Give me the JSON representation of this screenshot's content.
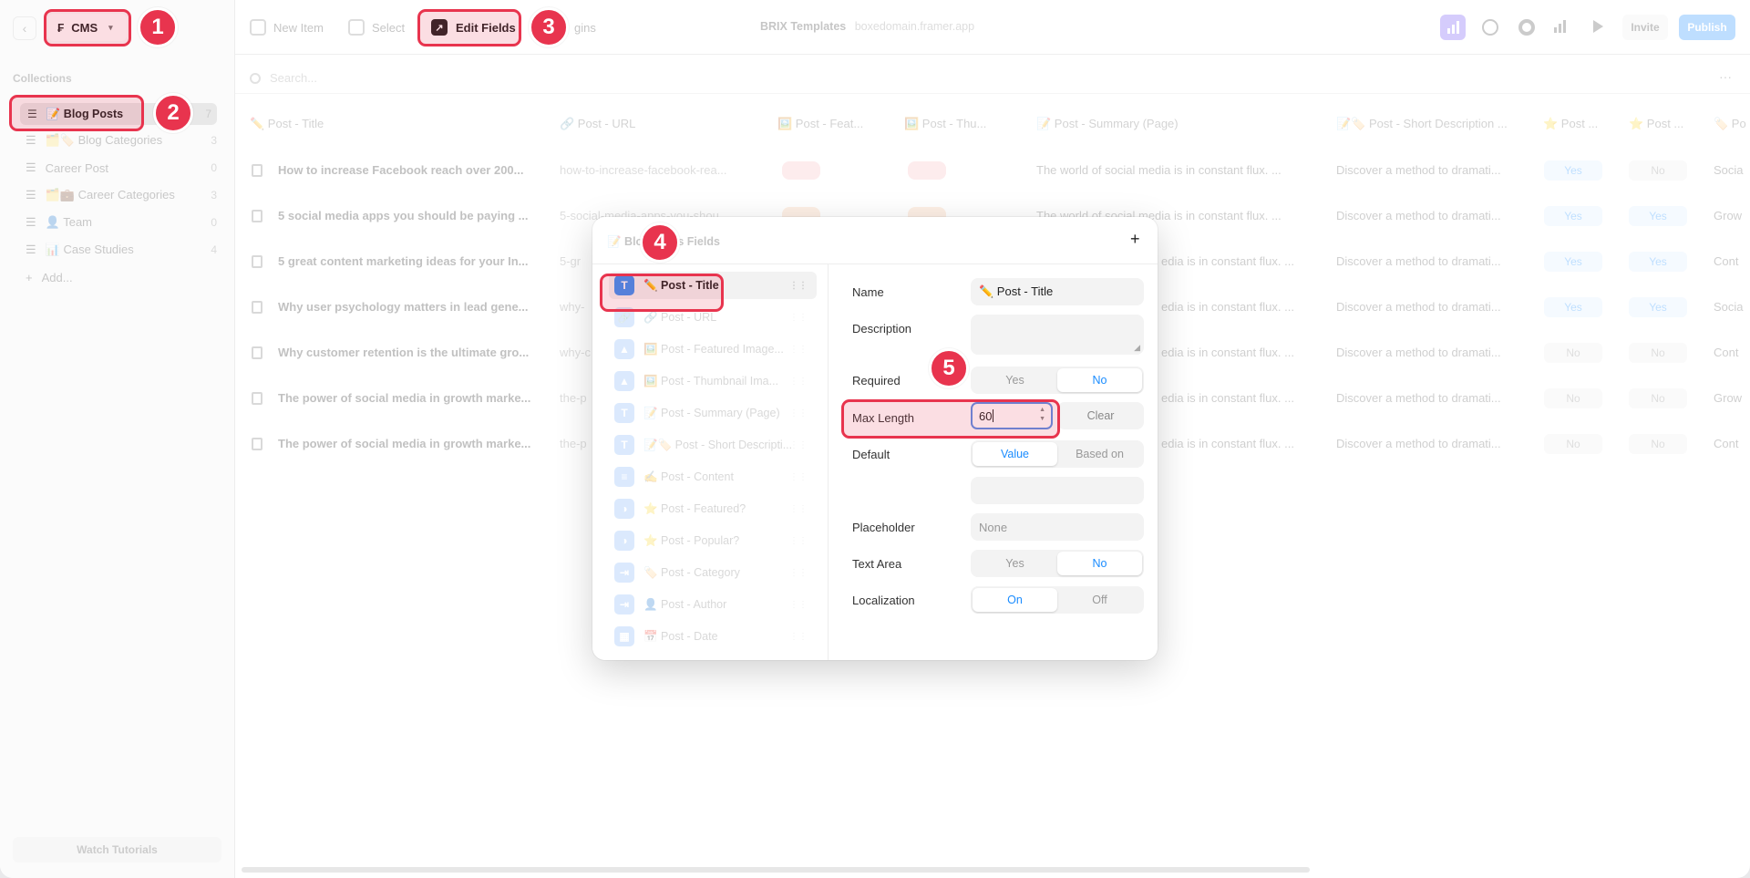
{
  "topbar": {
    "cms_label": "CMS",
    "new_item": "New Item",
    "select": "Select",
    "edit_fields": "Edit Fields",
    "plugins_partial": "gins",
    "project_name": "BRIX Templates",
    "project_domain": "boxedomain.framer.app",
    "invite": "Invite",
    "publish": "Publish"
  },
  "sidebar": {
    "section_title": "Collections",
    "items": [
      {
        "label": "📝 Blog Posts",
        "count": "7"
      },
      {
        "label": "🗂️🏷️ Blog Categories",
        "count": "3"
      },
      {
        "label": "Career Post",
        "count": "0"
      },
      {
        "label": "🗂️💼 Career Categories",
        "count": "3"
      },
      {
        "label": "👤 Team",
        "count": "0"
      },
      {
        "label": "📊 Case Studies",
        "count": "4"
      }
    ],
    "add_label": "Add...",
    "watch_tutorials": "Watch Tutorials"
  },
  "table": {
    "search_placeholder": "Search...",
    "columns": [
      "✏️ Post - Title",
      "🔗 Post - URL",
      "🖼️ Post - Feat...",
      "🖼️ Post - Thu...",
      "📝 Post - Summary (Page)",
      "📝🏷️ Post - Short Description ...",
      "⭐ Post ...",
      "⭐ Post ...",
      "🏷️ Po"
    ],
    "rows": [
      {
        "title": "How to increase Facebook reach over 200...",
        "url": "how-to-increase-facebook-rea...",
        "summary": "The world of social media is in constant flux. ...",
        "short": "Discover a method to dramati...",
        "f1": "Yes",
        "f2": "No",
        "cat": "Socia"
      },
      {
        "title": "5 social media apps you should be paying ...",
        "url": "5-social-media-apps-you-shou...",
        "summary": "The world of social media is in constant flux. ...",
        "short": "Discover a method to dramati...",
        "f1": "Yes",
        "f2": "Yes",
        "cat": "Grow"
      },
      {
        "title": "5 great content marketing ideas for your In...",
        "url": "5-gr",
        "summary": "edia is in constant flux. ...",
        "short": "Discover a method to dramati...",
        "f1": "Yes",
        "f2": "Yes",
        "cat": "Cont"
      },
      {
        "title": "Why user psychology matters in lead gene...",
        "url": "why-",
        "summary": "edia is in constant flux. ...",
        "short": "Discover a method to dramati...",
        "f1": "Yes",
        "f2": "Yes",
        "cat": "Socia"
      },
      {
        "title": "Why customer retention is the ultimate gro...",
        "url": "why-c",
        "summary": "edia is in constant flux. ...",
        "short": "Discover a method to dramati...",
        "f1": "No",
        "f2": "No",
        "cat": "Cont"
      },
      {
        "title": "The power of social media in growth marke...",
        "url": "the-p",
        "summary": "edia is in constant flux. ...",
        "short": "Discover a method to dramati...",
        "f1": "No",
        "f2": "No",
        "cat": "Grow"
      },
      {
        "title": "The power of social media in growth marke...",
        "url": "the-p",
        "summary": "edia is in constant flux. ...",
        "short": "Discover a method to dramati...",
        "f1": "No",
        "f2": "No",
        "cat": "Cont"
      }
    ]
  },
  "modal": {
    "title": "📝 Blog Posts Fields",
    "add_symbol": "+",
    "fields": [
      {
        "icon": "T",
        "label": "✏️ Post - Title"
      },
      {
        "icon": "🔗",
        "label": "🔗 Post - URL"
      },
      {
        "icon": "▲",
        "label": "🖼️ Post - Featured Image..."
      },
      {
        "icon": "▲",
        "label": "🖼️ Post - Thumbnail Ima..."
      },
      {
        "icon": "T",
        "label": "📝 Post - Summary (Page)"
      },
      {
        "icon": "T",
        "label": "📝🏷️ Post - Short Descripti..."
      },
      {
        "icon": "≡",
        "label": "✍️ Post - Content"
      },
      {
        "icon": "◑",
        "label": "⭐ Post - Featured?"
      },
      {
        "icon": "◑",
        "label": "⭐ Post - Popular?"
      },
      {
        "icon": "⇥",
        "label": "🏷️ Post - Category"
      },
      {
        "icon": "⇥",
        "label": "👤 Post - Author"
      },
      {
        "icon": "▦",
        "label": "📅 Post - Date"
      }
    ],
    "form": {
      "name_label": "Name",
      "name_value": "✏️ Post - Title",
      "description_label": "Description",
      "required_label": "Required",
      "required_yes": "Yes",
      "required_no": "No",
      "max_length_label": "Max Length",
      "max_length_value": "60",
      "clear_label": "Clear",
      "default_label": "Default",
      "default_value_opt": "Value",
      "default_based_opt": "Based on",
      "placeholder_label": "Placeholder",
      "placeholder_value": "None",
      "textarea_label": "Text Area",
      "textarea_yes": "Yes",
      "textarea_no": "No",
      "localization_label": "Localization",
      "localization_on": "On",
      "localization_off": "Off"
    }
  },
  "annotations": [
    "1",
    "2",
    "3",
    "4",
    "5"
  ],
  "colors": {
    "highlight": "#e8344e",
    "accent": "#1a8cff",
    "field_icon": "#3a8ff5",
    "publish": "#6bb8ff"
  }
}
